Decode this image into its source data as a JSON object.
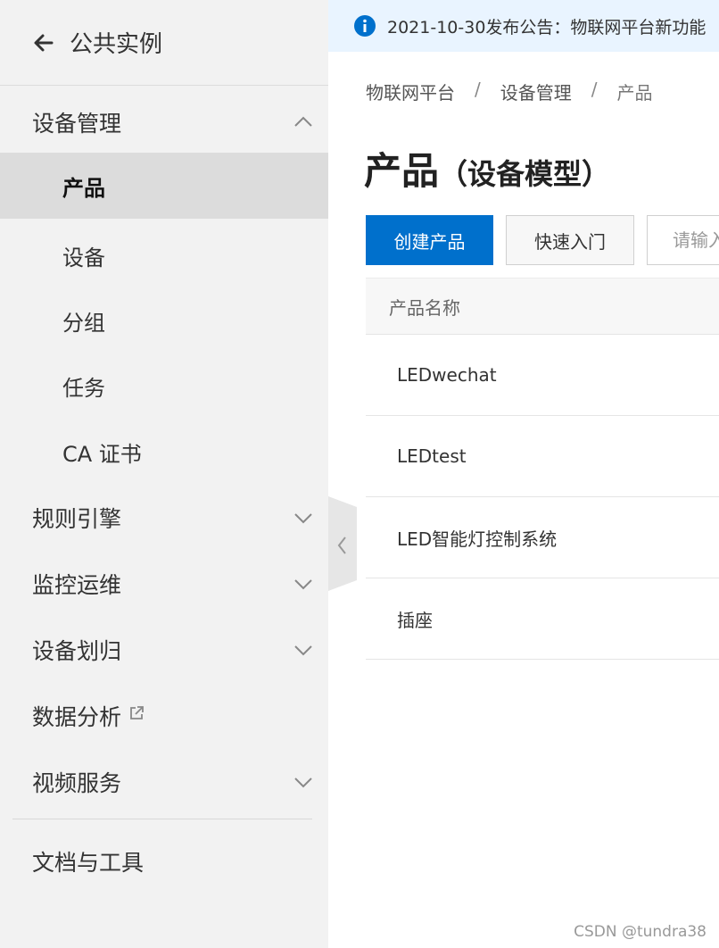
{
  "sidebar": {
    "back_label": "公共实例",
    "groups": {
      "device_mgmt": "设备管理",
      "rule_engine": "规则引擎",
      "monitor_ops": "监控运维",
      "device_assign": "设备划归",
      "data_analysis": "数据分析",
      "video_service": "视频服务",
      "docs_tools": "文档与工具"
    },
    "sub_items": {
      "product": "产品",
      "device": "设备",
      "group": "分组",
      "task": "任务",
      "ca_cert": "CA 证书"
    }
  },
  "notice": {
    "text": "2021-10-30发布公告：物联网平台新功能"
  },
  "breadcrumb": {
    "items": [
      "物联网平台",
      "设备管理",
      "产品"
    ],
    "separator": "/"
  },
  "page": {
    "title": "产品",
    "subtitle": "（设备模型）"
  },
  "toolbar": {
    "create_label": "创建产品",
    "quickstart_label": "快速入门",
    "search_placeholder": "请输入"
  },
  "table": {
    "header": "产品名称",
    "rows": [
      "LEDwechat",
      "LEDtest",
      "LED智能灯控制系统",
      "插座"
    ]
  },
  "watermark": "CSDN @tundra38",
  "colors": {
    "primary": "#0070cc",
    "sidebar_bg": "#f2f2f2",
    "active_item_bg": "#dcdcdc",
    "notice_bg": "#e9f4ff"
  }
}
